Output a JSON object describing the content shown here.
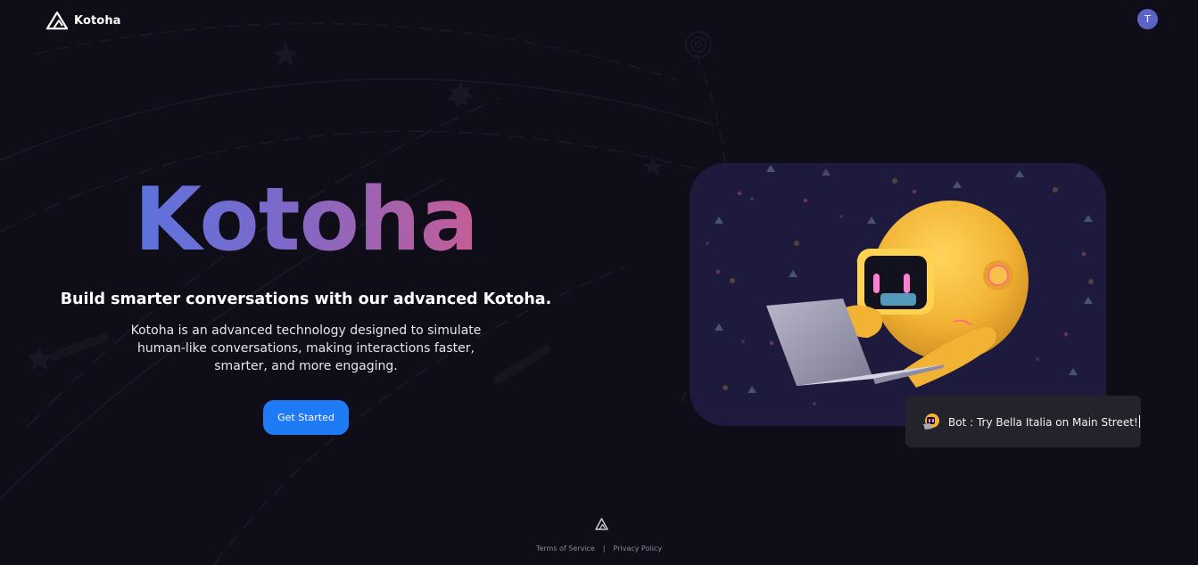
{
  "header": {
    "brand": "Kotoha",
    "avatar_initial": "T"
  },
  "hero": {
    "title": "Kotoha",
    "subtitle": "Build smarter conversations with our advanced Kotoha.",
    "description": "Kotoha is an advanced technology designed to simulate human-like conversations, making interactions faster, smarter, and more engaging.",
    "cta_label": "Get Started"
  },
  "chat": {
    "message": "Bot : Try Bella Italia on Main Street!"
  },
  "footer": {
    "terms": "Terms of Service",
    "separator": "|",
    "privacy": "Privacy Policy"
  },
  "colors": {
    "background": "#0f0d17",
    "accent": "#1e7af5",
    "avatar": "#5b63c7",
    "title_gradient": [
      "#3d7cf2",
      "#7c69c9",
      "#d45a8c",
      "#e95277"
    ],
    "chat_bubble": "#24232b"
  },
  "icons": {
    "brand_logo": "triangle-logo-icon",
    "chat_avatar": "robot-icon",
    "illustration": "robot-with-laptop-illustration"
  }
}
